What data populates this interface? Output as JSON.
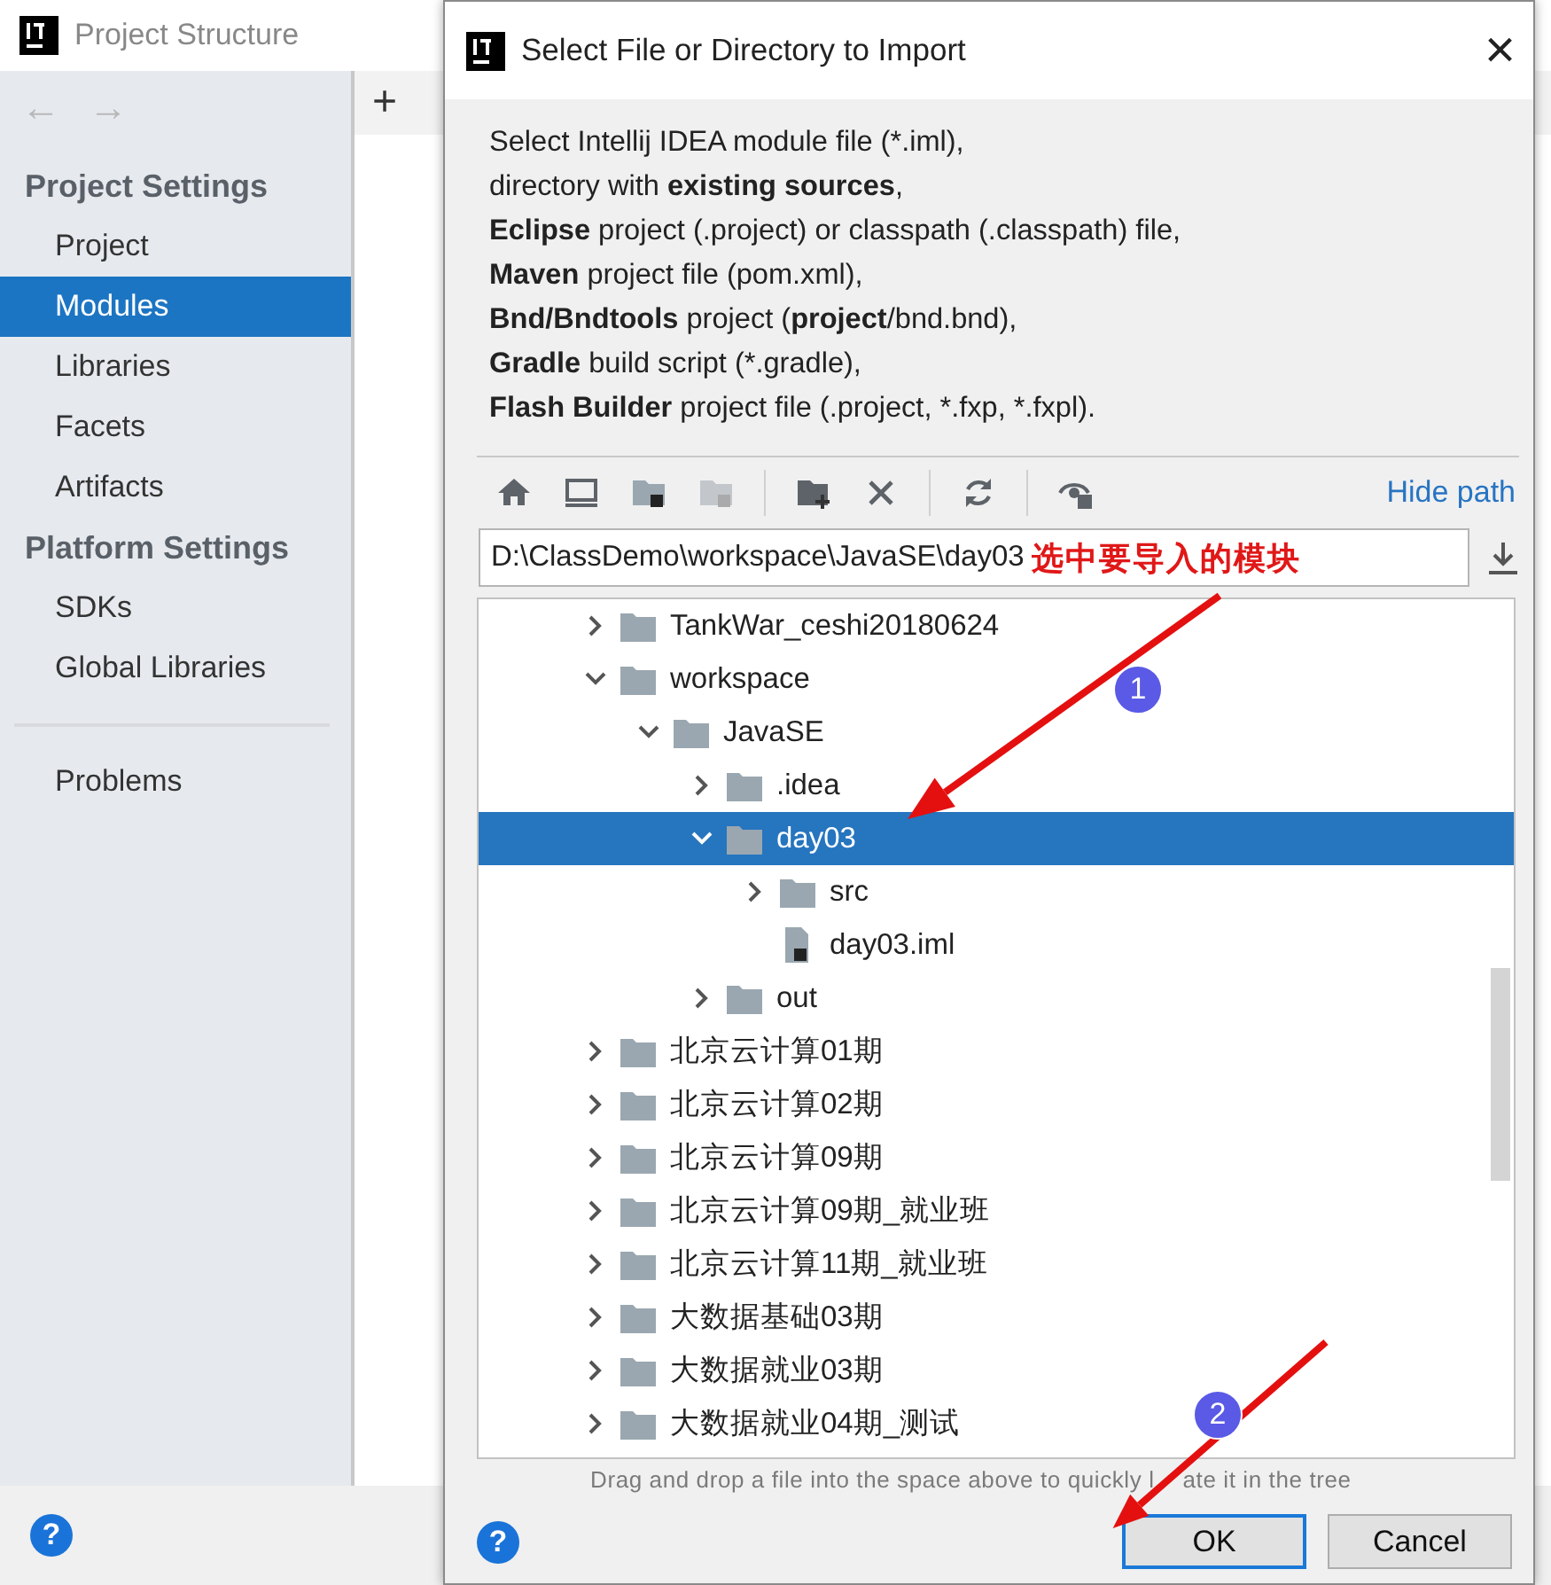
{
  "background_window": {
    "title": "Project Structure",
    "nav": [
      {
        "glyph": "←",
        "disabled": true
      },
      {
        "glyph": "→",
        "disabled": true
      }
    ],
    "add_button": "+",
    "sidebar": {
      "sections": [
        {
          "title": "Project Settings",
          "items": [
            {
              "label": "Project",
              "selected": false
            },
            {
              "label": "Modules",
              "selected": true
            },
            {
              "label": "Libraries",
              "selected": false
            },
            {
              "label": "Facets",
              "selected": false
            },
            {
              "label": "Artifacts",
              "selected": false
            }
          ]
        },
        {
          "title": "Platform Settings",
          "items": [
            {
              "label": "SDKs",
              "selected": false
            },
            {
              "label": "Global Libraries",
              "selected": false
            }
          ]
        }
      ],
      "bottom_items": [
        {
          "label": "Problems",
          "selected": false
        }
      ]
    },
    "help": "?"
  },
  "dialog": {
    "title": "Select File or Directory to Import",
    "close": "×",
    "description": [
      "Select Intellij IDEA module file (*.iml),",
      "directory with **existing sources**,",
      "**Eclipse** project (.project) or classpath (.classpath) file,",
      "**Maven** project file (pom.xml),",
      "**Bnd/Bndtools** project (**project**/bnd.bnd),",
      "**Gradle** build script (*.gradle),",
      "**Flash Builder** project file (.project, *.fxp, *.fxpl)."
    ],
    "toolbar": [
      {
        "kind": "home",
        "disabled": false
      },
      {
        "kind": "desktop",
        "disabled": false
      },
      {
        "kind": "project",
        "disabled": false
      },
      {
        "kind": "module",
        "disabled": true
      },
      {
        "kind": "sep"
      },
      {
        "kind": "new-folder",
        "disabled": false
      },
      {
        "kind": "delete",
        "disabled": false
      },
      {
        "kind": "sep"
      },
      {
        "kind": "refresh",
        "disabled": false
      },
      {
        "kind": "sep"
      },
      {
        "kind": "hidden",
        "disabled": false
      }
    ],
    "hide_path": "Hide path",
    "path_field": {
      "value": "D:\\ClassDemo\\workspace\\JavaSE\\day03",
      "annotation": "选中要导入的模块"
    },
    "tree": [
      {
        "name": "TankWar_ceshi20180624",
        "kind": "folder",
        "expanded": false,
        "selected": false
      },
      {
        "name": "workspace",
        "kind": "folder",
        "expanded": true,
        "selected": false,
        "children": [
          {
            "name": "JavaSE",
            "kind": "folder",
            "expanded": true,
            "selected": false,
            "children": [
              {
                "name": ".idea",
                "kind": "folder",
                "expanded": false,
                "selected": false
              },
              {
                "name": "day03",
                "kind": "folder",
                "expanded": true,
                "selected": true,
                "children": [
                  {
                    "name": "src",
                    "kind": "folder",
                    "expanded": false,
                    "selected": false
                  },
                  {
                    "name": "day03.iml",
                    "kind": "file",
                    "selected": false
                  }
                ]
              },
              {
                "name": "out",
                "kind": "folder",
                "expanded": false,
                "selected": false
              }
            ]
          }
        ]
      },
      {
        "name": "北京云计算01期",
        "kind": "folder",
        "expanded": false,
        "selected": false
      },
      {
        "name": "北京云计算02期",
        "kind": "folder",
        "expanded": false,
        "selected": false
      },
      {
        "name": "北京云计算09期",
        "kind": "folder",
        "expanded": false,
        "selected": false
      },
      {
        "name": "北京云计算09期_就业班",
        "kind": "folder",
        "expanded": false,
        "selected": false
      },
      {
        "name": "北京云计算11期_就业班",
        "kind": "folder",
        "expanded": false,
        "selected": false
      },
      {
        "name": "大数据基础03期",
        "kind": "folder",
        "expanded": false,
        "selected": false
      },
      {
        "name": "大数据就业03期",
        "kind": "folder",
        "expanded": false,
        "selected": false
      },
      {
        "name": "大数据就业04期_测试",
        "kind": "folder",
        "expanded": false,
        "selected": false
      }
    ],
    "hint": [
      "Drag and drop a file into the space above to quickly l",
      "ate it in the tree"
    ],
    "help": "?",
    "buttons": [
      {
        "label": "OK",
        "default": true
      },
      {
        "label": "Cancel",
        "default": false
      }
    ]
  },
  "annotations": [
    {
      "label": "1"
    },
    {
      "label": "2"
    }
  ]
}
